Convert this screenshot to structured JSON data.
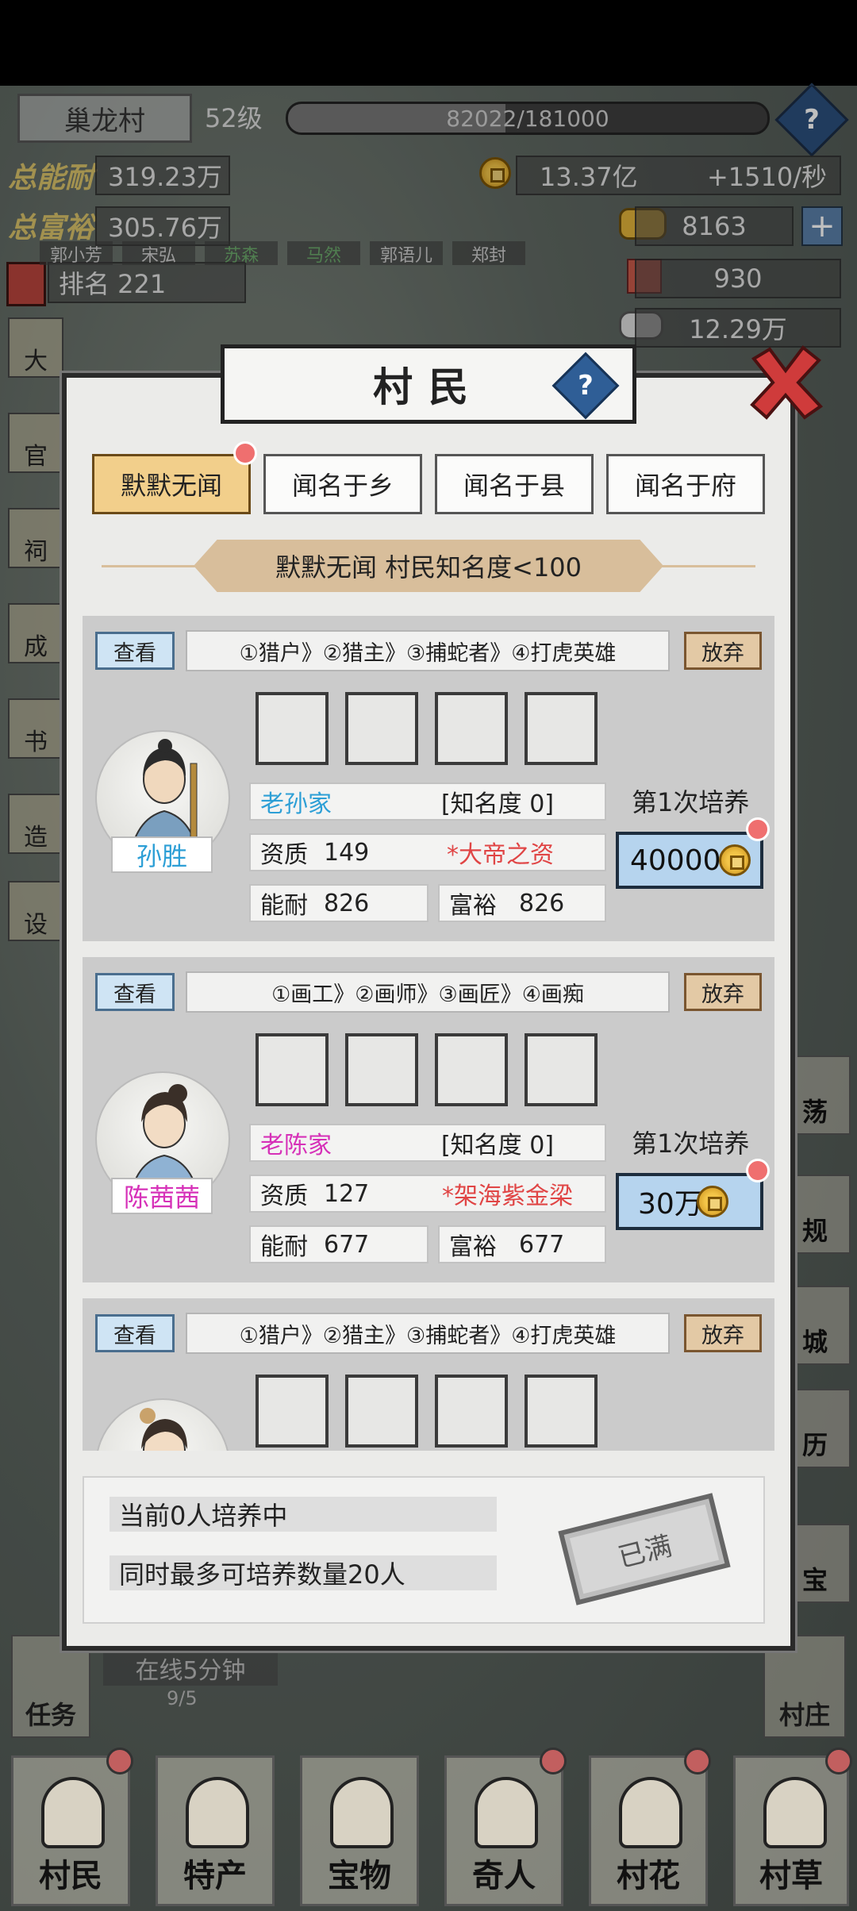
{
  "hud": {
    "village_name": "巢龙村",
    "level": "52级",
    "xp_text": "82022/181000",
    "xp_progress": 0.453,
    "help_icon": "?",
    "total_ability_label": "总能耐",
    "total_ability_value": "319.23万",
    "total_wealth_label": "总富裕",
    "total_wealth_value": "305.76万",
    "coins_value": "13.37亿",
    "coins_rate": "+1510/秒",
    "gold_value": "8163",
    "plus_icon": "+",
    "ticket_value": "930",
    "silver_value": "12.29万",
    "rank_text": "排名 221",
    "avatars": [
      "郭小芳",
      "宋弘",
      "苏森",
      "马然",
      "郭语儿",
      "郑封"
    ]
  },
  "dialog": {
    "title": "村民",
    "title_help": "?",
    "tabs": [
      {
        "label": "默默无闻",
        "active": true,
        "has_dot": true
      },
      {
        "label": "闻名于乡",
        "active": false,
        "has_dot": false
      },
      {
        "label": "闻名于县",
        "active": false,
        "has_dot": false
      },
      {
        "label": "闻名于府",
        "active": false,
        "has_dot": false
      }
    ],
    "banner": "默默无闻  村民知名度<100",
    "cards": [
      {
        "view_label": "查看",
        "quit_label": "放弃",
        "career_path": "①猎户》②猎主》③捕蛇者》④打虎英雄",
        "name": "孙胜",
        "name_color": "#2d9fd6",
        "family": "老孙家",
        "family_color": "#2d9fd6",
        "fame": "[知名度 0]",
        "aptitude_label": "资质",
        "aptitude_value": "149",
        "talent": "*大帝之资",
        "ability_label": "能耐",
        "ability_value": "826",
        "wealth_label": "富裕",
        "wealth_value": "826",
        "train_label": "第1次培养",
        "cost": "40000"
      },
      {
        "view_label": "查看",
        "quit_label": "放弃",
        "career_path": "①画工》②画师》③画匠》④画痴",
        "name": "陈茜茜",
        "name_color": "#d631b8",
        "family": "老陈家",
        "family_color": "#d631b8",
        "fame": "[知名度 0]",
        "aptitude_label": "资质",
        "aptitude_value": "127",
        "talent": "*架海紫金梁",
        "ability_label": "能耐",
        "ability_value": "677",
        "wealth_label": "富裕",
        "wealth_value": "677",
        "train_label": "第1次培养",
        "cost": "30万"
      },
      {
        "view_label": "查看",
        "quit_label": "放弃",
        "career_path": "①猎户》②猎主》③捕蛇者》④打虎英雄"
      }
    ],
    "summary_line1": "当前0人培养中",
    "summary_line2": "同时最多可培养数量20人",
    "full_stamp": "已满"
  },
  "background": {
    "online_text": "在线5分钟",
    "online_count": "9/5",
    "task_label": "任务",
    "village_label": "村庄",
    "left_side": [
      "大",
      "官",
      "祠",
      "成",
      "书",
      "造",
      "设"
    ],
    "right_side": [
      "荡",
      "规",
      "城",
      "历",
      "宝"
    ]
  },
  "bottom_nav": [
    "村民",
    "特产",
    "宝物",
    "奇人",
    "村花",
    "村草"
  ],
  "colors": {
    "talent_red": "#e04545",
    "tab_active": "#f2cf8b",
    "cost_button": "#b6d4ee"
  }
}
